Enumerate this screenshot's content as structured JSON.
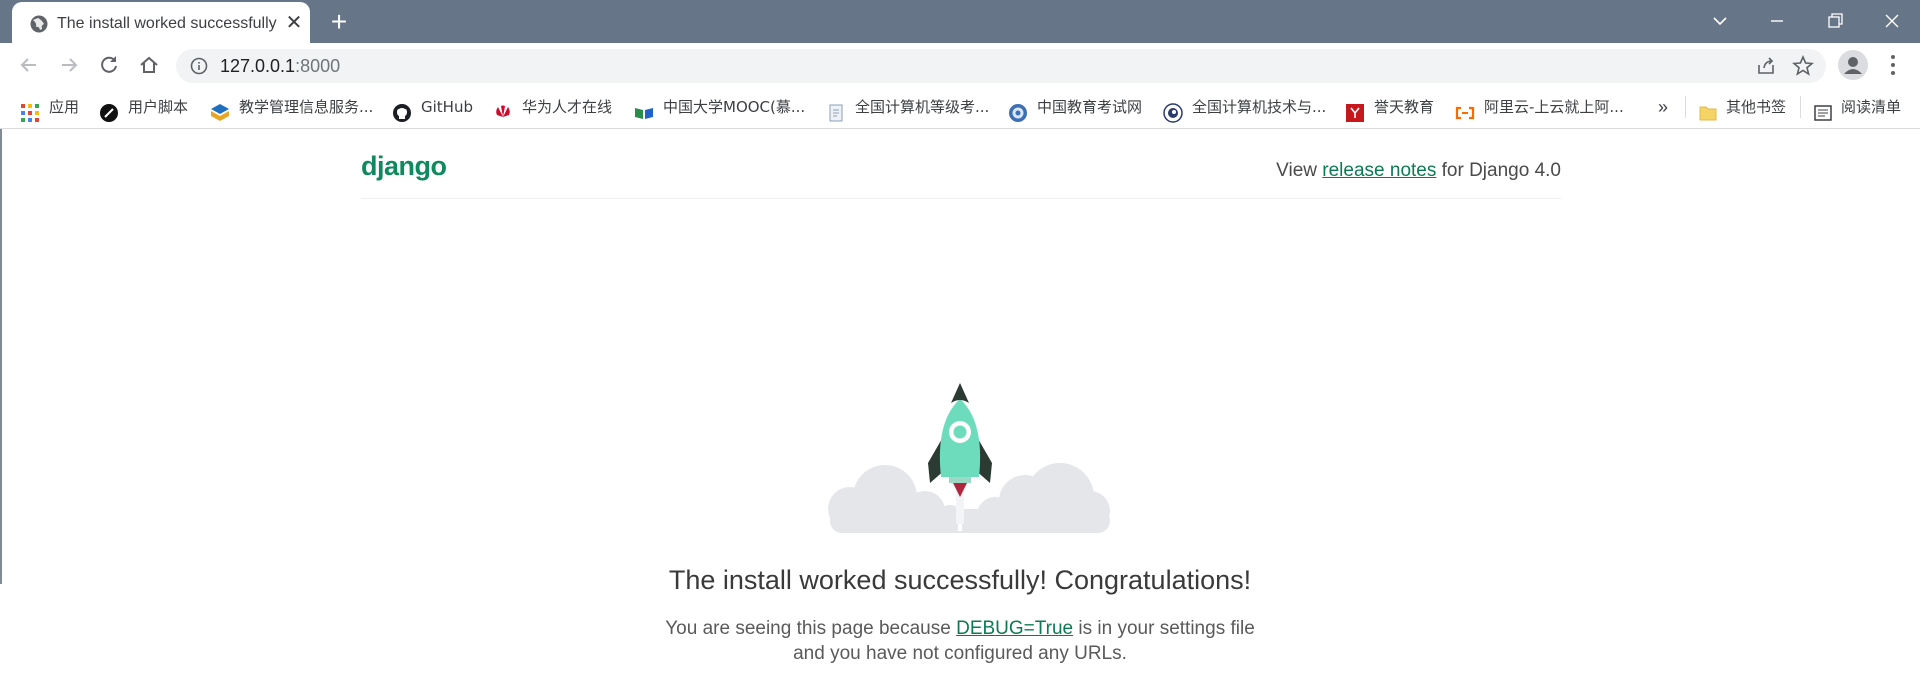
{
  "browser": {
    "tab": {
      "title": "The install worked successfully",
      "favicon": "globe-icon"
    },
    "new_tab": "+",
    "window_controls": [
      "chevron-down-icon",
      "minimize-icon",
      "restore-icon",
      "close-icon"
    ],
    "toolbar": {
      "url_host": "127.0.0.1",
      "url_port": ":8000"
    },
    "bookmarks": [
      {
        "label": "应用",
        "icon": "apps-grid-icon"
      },
      {
        "label": "用户脚本",
        "icon": "userscript-icon"
      },
      {
        "label": "教学管理信息服务...",
        "icon": "colorful-logo-icon"
      },
      {
        "label": "GitHub",
        "icon": "github-icon"
      },
      {
        "label": "华为人才在线",
        "icon": "huawei-icon"
      },
      {
        "label": "中国大学MOOC(慕...",
        "icon": "mooc-icon"
      },
      {
        "label": "全国计算机等级考...",
        "icon": "document-icon"
      },
      {
        "label": "中国教育考试网",
        "icon": "seal-icon"
      },
      {
        "label": "全国计算机技术与...",
        "icon": "circle-logo-icon"
      },
      {
        "label": "誉天教育",
        "icon": "red-square-icon"
      },
      {
        "label": "阿里云-上云就上阿...",
        "icon": "aliyun-icon"
      }
    ],
    "bookmarks_more": "»",
    "other_bookmarks": "其他书签",
    "reading_list": "阅读清单"
  },
  "page": {
    "logo": "django",
    "notes_prefix": "View ",
    "notes_link": "release notes",
    "notes_suffix": " for Django 4.0",
    "headline": "The install worked successfully! Congratulations!",
    "desc_prefix": "You are seeing this page because ",
    "desc_link": "DEBUG=True",
    "desc_suffix": " is in your settings file and you have not configured any URLs."
  },
  "colors": {
    "tabstrip": "#677589",
    "django_green": "#0f8a5f",
    "rocket_body": "#6ddcbd"
  }
}
